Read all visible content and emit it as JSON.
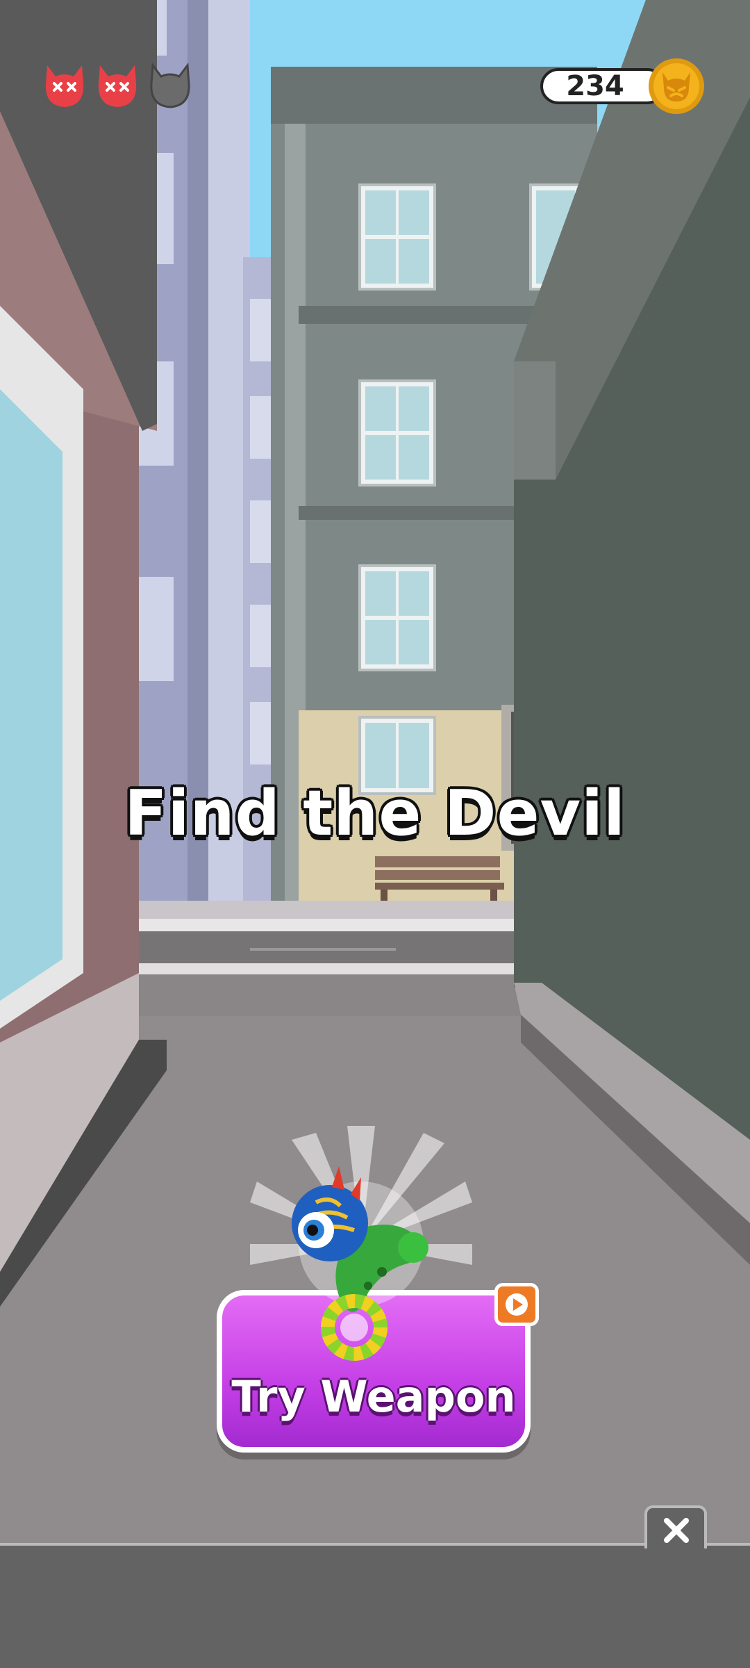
{
  "hud": {
    "lives": [
      {
        "state": "lost",
        "icon": "devil-face-x-icon",
        "color": "#e94048"
      },
      {
        "state": "lost",
        "icon": "devil-face-x-icon",
        "color": "#e94048"
      },
      {
        "state": "remaining",
        "icon": "devil-face-icon",
        "color": "#6b6b6b"
      }
    ],
    "coins": "234",
    "coin_icon": "devil-coin-icon",
    "coin_color": "#f4b21c"
  },
  "title": "Find the Devil",
  "try_weapon": {
    "label": "Try Weapon",
    "ad_icon": "play-video-icon",
    "weapon_icon": "monster-blaster-icon",
    "button_color": "#c43ee6"
  },
  "close": {
    "icon": "close-icon"
  }
}
